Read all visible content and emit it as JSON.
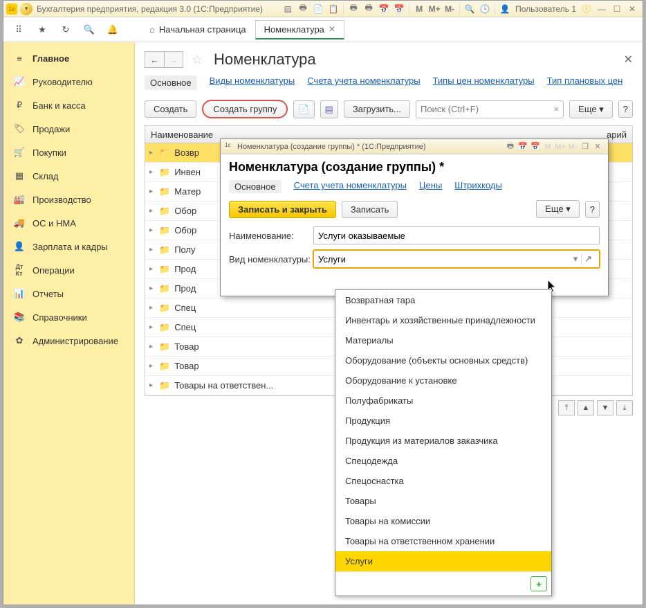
{
  "app": {
    "title": "Бухгалтерия предприятия, редакция 3.0  (1С:Предприятие)",
    "user": "Пользователь 1"
  },
  "tabs": {
    "home": "Начальная страница",
    "active": "Номенклатура"
  },
  "sidebar": {
    "items": [
      {
        "label": "Главное"
      },
      {
        "label": "Руководителю"
      },
      {
        "label": "Банк и касса"
      },
      {
        "label": "Продажи"
      },
      {
        "label": "Покупки"
      },
      {
        "label": "Склад"
      },
      {
        "label": "Производство"
      },
      {
        "label": "ОС и НМА"
      },
      {
        "label": "Зарплата и кадры"
      },
      {
        "label": "Операции"
      },
      {
        "label": "Отчеты"
      },
      {
        "label": "Справочники"
      },
      {
        "label": "Администрирование"
      }
    ]
  },
  "page": {
    "title": "Номенклатура",
    "links": {
      "main": "Основное",
      "kinds": "Виды номенклатуры",
      "accounts": "Счета учета номенклатуры",
      "pricetypes": "Типы цен номенклатуры",
      "plan": "Тип плановых цен"
    },
    "buttons": {
      "create": "Создать",
      "create_group": "Создать группу",
      "load": "Загрузить...",
      "more": "Еще"
    },
    "search_placeholder": "Поиск (Ctrl+F)",
    "col_name": "Наименование",
    "col_comment_suffix": "арий",
    "rows": [
      {
        "label": "Возвр"
      },
      {
        "label": "Инвен"
      },
      {
        "label": "Матер"
      },
      {
        "label": "Обор"
      },
      {
        "label": "Обор"
      },
      {
        "label": "Полу"
      },
      {
        "label": "Прод"
      },
      {
        "label": "Прод"
      },
      {
        "label": "Спец"
      },
      {
        "label": "Спец"
      },
      {
        "label": "Товар"
      },
      {
        "label": "Товар"
      },
      {
        "label": "Товары на ответствен..."
      }
    ]
  },
  "modal": {
    "title": "Номенклатура (создание группы) *  (1С:Предприятие)",
    "heading": "Номенклатура (создание группы) *",
    "links": {
      "main": "Основное",
      "accounts": "Счета учета номенклатуры",
      "prices": "Цены",
      "barcodes": "Штрихкоды"
    },
    "buttons": {
      "save_close": "Записать и закрыть",
      "save": "Записать",
      "more": "Еще"
    },
    "fields": {
      "name_label": "Наименование:",
      "name_value": "Услуги оказываемые",
      "kind_label": "Вид номенклатуры:",
      "kind_value": "Услуги"
    }
  },
  "dropdown": {
    "items": [
      "Возвратная тара",
      "Инвентарь и хозяйственные принадлежности",
      "Материалы",
      "Оборудование (объекты основных средств)",
      "Оборудование к установке",
      "Полуфабрикаты",
      "Продукция",
      "Продукция из материалов заказчика",
      "Спецодежда",
      "Спецоснастка",
      "Товары",
      "Товары на комиссии",
      "Товары на ответственном хранении",
      "Услуги"
    ],
    "selected": "Услуги"
  }
}
